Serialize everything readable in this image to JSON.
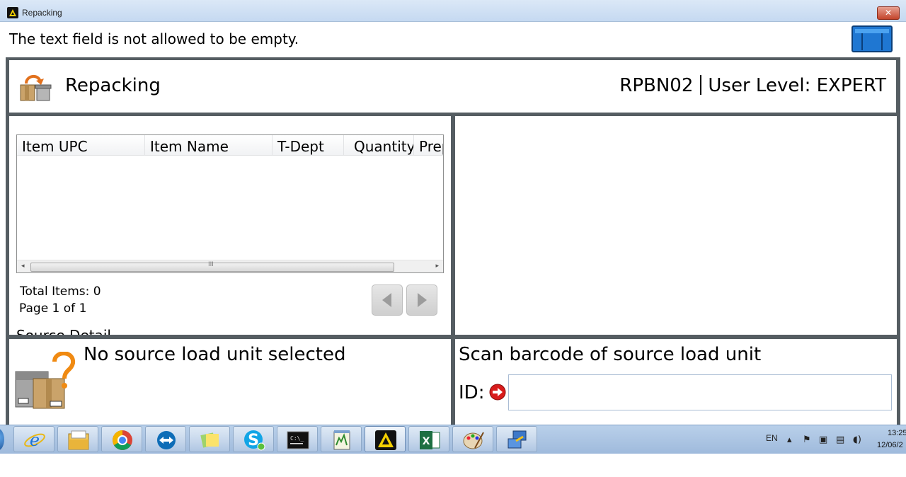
{
  "window": {
    "title": "Repacking",
    "close_label": "✕"
  },
  "message": {
    "text": "The text field is not allowed to be empty."
  },
  "header": {
    "title": "Repacking",
    "station": "RPBN02",
    "user_level": "User Level: EXPERT"
  },
  "table": {
    "columns": [
      "Item UPC",
      "Item Name",
      "T-Dept",
      "Quantity",
      "Prep"
    ],
    "rows": []
  },
  "summary": {
    "total_items": "Total Items: 0",
    "page_info": "Page 1 of 1",
    "section_cut": "Source Detail"
  },
  "source": {
    "status": "No source load unit selected"
  },
  "scan": {
    "prompt": "Scan barcode of source load unit",
    "id_label": "ID:",
    "id_value": ""
  },
  "taskbar": {
    "apps": [
      "internet-explorer-icon",
      "file-explorer-icon",
      "chrome-icon",
      "teamviewer-icon",
      "sticky-notes-icon",
      "skype-icon",
      "command-prompt-icon",
      "notepad-icon",
      "repacking-app-icon",
      "excel-icon",
      "paint-icon",
      "remote-desktop-icon"
    ],
    "language": "EN",
    "time": "13:25",
    "date": "12/06/2"
  },
  "colors": {
    "frame": "#555d62",
    "title_bar": "#c5d9f1",
    "taskbar": "#a9c3e3",
    "close_button": "#c3442b"
  }
}
